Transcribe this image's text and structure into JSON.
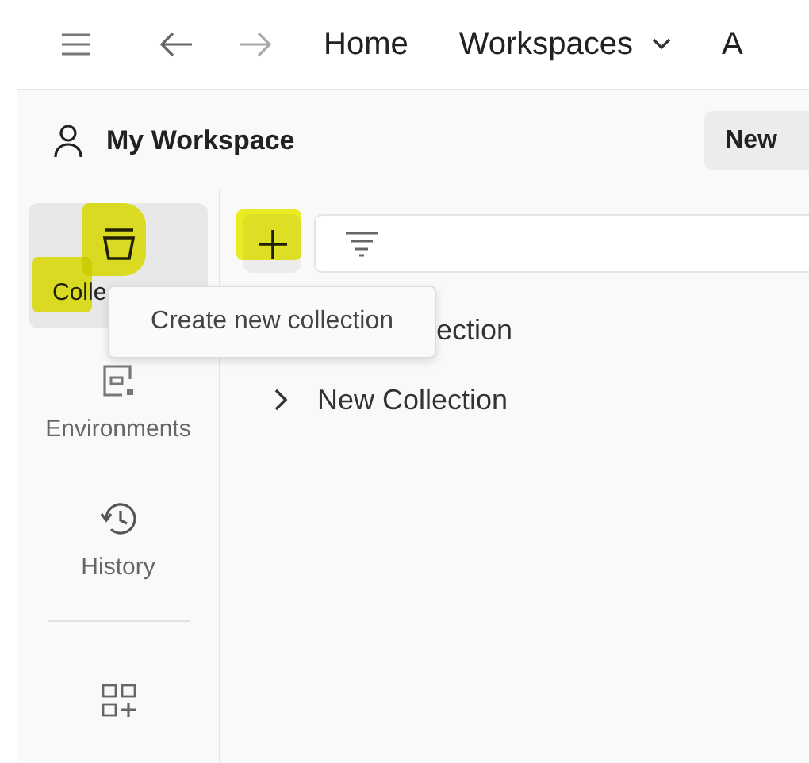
{
  "topbar": {
    "nav": [
      {
        "label": "Home",
        "dropdown": false
      },
      {
        "label": "Workspaces",
        "dropdown": true
      },
      {
        "label": "A",
        "dropdown": false
      }
    ]
  },
  "workspace": {
    "title": "My Workspace",
    "new_button": "New"
  },
  "sidebar": {
    "items": [
      {
        "kind": "collections",
        "label": "Colle",
        "selected": true,
        "covered": true
      },
      {
        "kind": "environments",
        "label": "Environments",
        "selected": false,
        "covered": false
      },
      {
        "kind": "history",
        "label": "History",
        "selected": false,
        "covered": false
      },
      {
        "kind": "apps",
        "selected": false
      }
    ]
  },
  "tooltip": {
    "text": "Create new collection"
  },
  "collections": [
    {
      "label": "ection",
      "covered": true
    },
    {
      "label": "New Collection",
      "covered": false
    }
  ]
}
